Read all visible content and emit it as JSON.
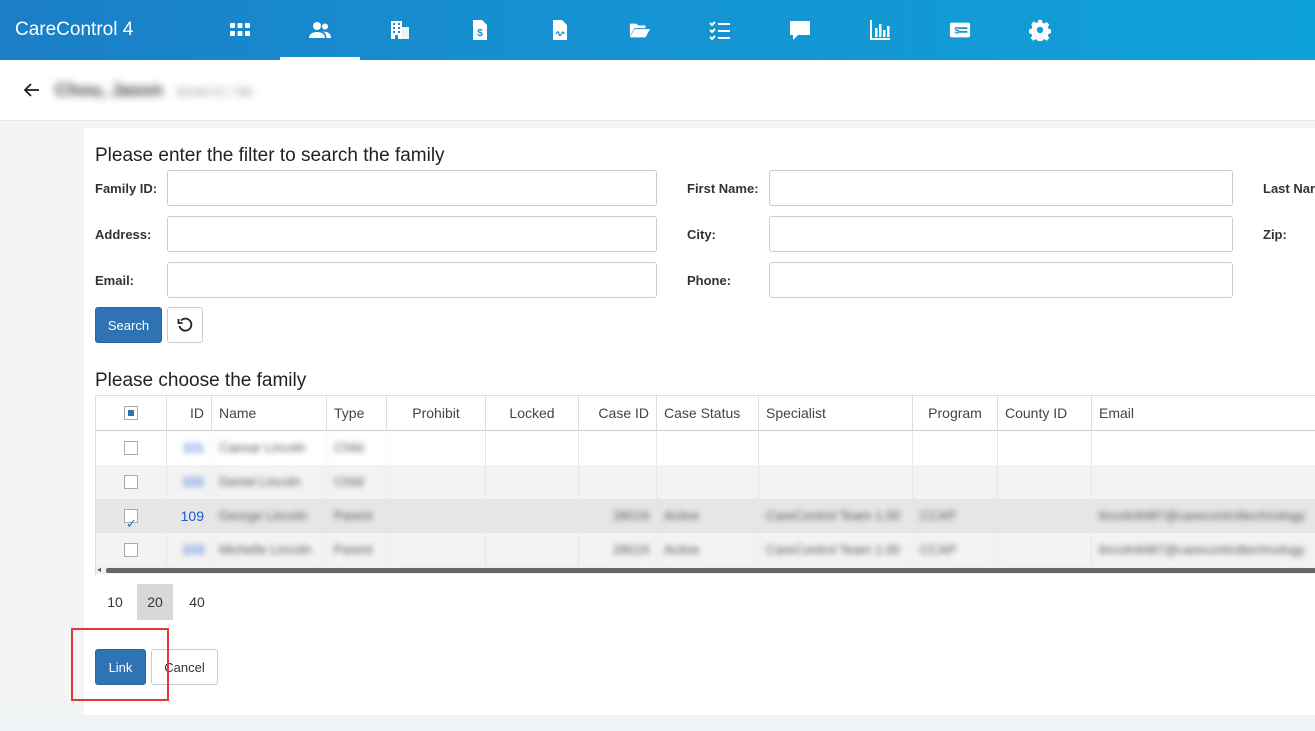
{
  "app": {
    "title": "CareControl 4"
  },
  "nav": [
    {
      "icon": "apps-grid-icon"
    },
    {
      "icon": "people-icon",
      "active": true
    },
    {
      "icon": "building-icon"
    },
    {
      "icon": "invoice-dollar-icon"
    },
    {
      "icon": "signed-document-icon"
    },
    {
      "icon": "folder-open-icon"
    },
    {
      "icon": "checklist-icon"
    },
    {
      "icon": "chat-icon"
    },
    {
      "icon": "chart-bar-icon"
    },
    {
      "icon": "money-card-icon"
    },
    {
      "icon": "gear-icon"
    }
  ],
  "subheader": {
    "name": "Chou, Jason",
    "sub": "Enrld #1 / 9A"
  },
  "search": {
    "title": "Please enter the filter to search the family",
    "labels": {
      "family_id": "Family ID:",
      "first_name": "First Name:",
      "last_name": "Last Nar",
      "address": "Address:",
      "city": "City:",
      "zip": "Zip:",
      "email": "Email:",
      "phone": "Phone:"
    },
    "values": {
      "family_id": "",
      "first_name": "",
      "address": "",
      "city": "",
      "email": "",
      "phone": ""
    },
    "search_button": "Search"
  },
  "family": {
    "title": "Please choose the family",
    "columns": [
      "ID",
      "Name",
      "Type",
      "Prohibit",
      "Locked",
      "Case ID",
      "Case Status",
      "Specialist",
      "Program",
      "County ID",
      "Email"
    ],
    "rows": [
      {
        "checked": false,
        "id": "101",
        "name": "Caesar Lincoln",
        "type": "Child",
        "case_id": "",
        "status": "",
        "specialist": "",
        "program": "",
        "email": ""
      },
      {
        "checked": false,
        "id": "102",
        "name": "Daniel Lincoln",
        "type": "Child",
        "case_id": "",
        "status": "",
        "specialist": "",
        "program": "",
        "email": ""
      },
      {
        "checked": true,
        "id": "109",
        "name": "George Lincoln",
        "type": "Parent",
        "case_id": "28019",
        "status": "Active",
        "specialist": "CareControl Team 1.00",
        "program": "CCAP",
        "email": "lincoln9487@carecontroltechnology"
      },
      {
        "checked": false,
        "id": "103",
        "name": "Michelle Lincoln",
        "type": "Parent",
        "case_id": "28019",
        "status": "Active",
        "specialist": "CareControl Team 1.00",
        "program": "CCAP",
        "email": "lincoln9487@carecontroltechnology"
      }
    ]
  },
  "pager": [
    "10",
    "20",
    "40"
  ],
  "pager_active": "20",
  "actions": {
    "link": "Link",
    "cancel": "Cancel"
  },
  "colors": {
    "brand": "#1b7ec7",
    "primary_button": "#2f73b4",
    "highlight": "#e53935"
  }
}
